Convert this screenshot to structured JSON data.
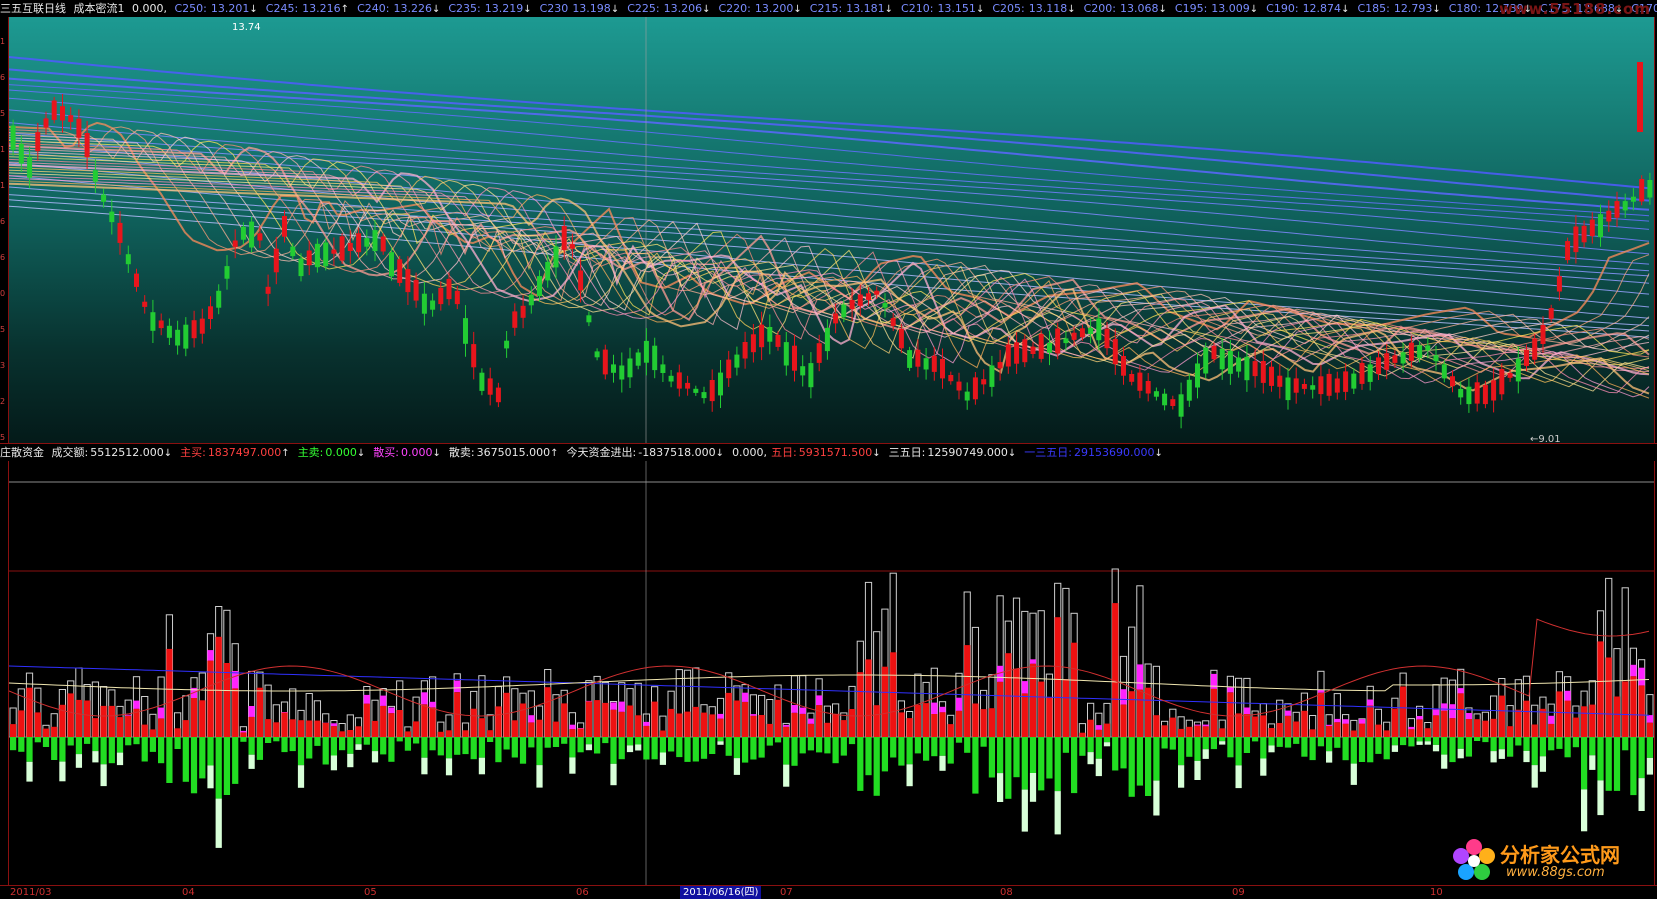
{
  "header_top": {
    "title": "三五互联日线",
    "indicator": "成本密流1",
    "indicator_value": "0.000,",
    "cost_lines": [
      {
        "label": "C250:",
        "value": "13.201",
        "dir": "↓"
      },
      {
        "label": "C245:",
        "value": "13.216",
        "dir": "↑"
      },
      {
        "label": "C240:",
        "value": "13.226",
        "dir": "↓"
      },
      {
        "label": "C235:",
        "value": "13.219",
        "dir": "↓"
      },
      {
        "label": "C230",
        "value": "13.198",
        "dir": "↓"
      },
      {
        "label": "C225:",
        "value": "13.206",
        "dir": "↓"
      },
      {
        "label": "C220:",
        "value": "13.200",
        "dir": "↓"
      },
      {
        "label": "C215:",
        "value": "13.181",
        "dir": "↓"
      },
      {
        "label": "C210:",
        "value": "13.151",
        "dir": "↓"
      },
      {
        "label": "C205:",
        "value": "13.118",
        "dir": "↓"
      },
      {
        "label": "C200:",
        "value": "13.068",
        "dir": "↓"
      },
      {
        "label": "C195:",
        "value": "13.009",
        "dir": "↓"
      },
      {
        "label": "C190:",
        "value": "12.874",
        "dir": "↓"
      },
      {
        "label": "C185:",
        "value": "12.793",
        "dir": "↓"
      },
      {
        "label": "C180:",
        "value": "12.739",
        "dir": "↓"
      },
      {
        "label": "C175:",
        "value": "12.688",
        "dir": "↓"
      },
      {
        "label": "C170:",
        "value": "",
        "dir": ""
      }
    ],
    "watermark": "www.55188.com"
  },
  "price_chart": {
    "high_label": "13.74",
    "low_label": "9.01",
    "colors": {
      "up": "#e8151c",
      "down": "#22cc33",
      "cost_warm": "#ff8a55",
      "cost_cool": "#7b7bff"
    }
  },
  "header_mid": {
    "title": "庄散资金",
    "items": [
      {
        "label": "成交额:",
        "value": "5512512.000",
        "dir": "↓",
        "color": "white"
      },
      {
        "label": "主买:",
        "value": "1837497.000",
        "dir": "↑",
        "color": "red"
      },
      {
        "label": "主卖:",
        "value": "0.000",
        "dir": "↓",
        "color": "green"
      },
      {
        "label": "散买:",
        "value": "0.000",
        "dir": "↓",
        "color": "magenta"
      },
      {
        "label": "散卖:",
        "value": "3675015.000",
        "dir": "↑",
        "color": "white"
      },
      {
        "label": "今天资金进出:",
        "value": "-1837518.000",
        "dir": "↓",
        "color": "white"
      },
      {
        "label": "",
        "value": "0.000,",
        "dir": "",
        "color": "white"
      },
      {
        "label": "五日:",
        "value": "5931571.500",
        "dir": "↓",
        "color": "red"
      },
      {
        "label": "三五日:",
        "value": "12590749.000",
        "dir": "↓",
        "color": "white"
      },
      {
        "label": "一三五日:",
        "value": "29153690.000",
        "dir": "↓",
        "color": "darkblue"
      }
    ]
  },
  "date_axis": {
    "labels": [
      "2011/03",
      "04",
      "05",
      "06",
      "07",
      "08",
      "09",
      "10"
    ],
    "cursor_date": "2011/06/16(四)"
  },
  "left_scale": [
    "1",
    "6",
    "5",
    "1",
    "1",
    "6",
    "6",
    "0",
    "5",
    "3",
    "2",
    "5"
  ],
  "logo": {
    "name": "分析家公式网",
    "url": "www.88gs.com"
  }
}
